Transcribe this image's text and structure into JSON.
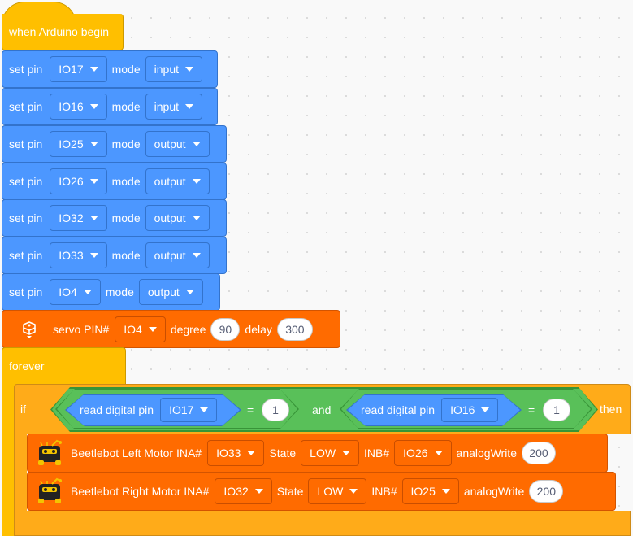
{
  "hat": {
    "label": "when Arduino begin"
  },
  "set_pin_blocks": [
    {
      "prefix": "set pin",
      "pin": "IO17",
      "mode_label": "mode",
      "mode": "input"
    },
    {
      "prefix": "set pin",
      "pin": "IO16",
      "mode_label": "mode",
      "mode": "input"
    },
    {
      "prefix": "set pin",
      "pin": "IO25",
      "mode_label": "mode",
      "mode": "output"
    },
    {
      "prefix": "set pin",
      "pin": "IO26",
      "mode_label": "mode",
      "mode": "output"
    },
    {
      "prefix": "set pin",
      "pin": "IO32",
      "mode_label": "mode",
      "mode": "output"
    },
    {
      "prefix": "set pin",
      "pin": "IO33",
      "mode_label": "mode",
      "mode": "output"
    },
    {
      "prefix": "set pin",
      "pin": "IO4",
      "mode_label": "mode",
      "mode": "output"
    }
  ],
  "servo": {
    "label": "servo PIN#",
    "pin": "IO4",
    "degree_label": "degree",
    "degree": "90",
    "delay_label": "delay",
    "delay": "300",
    "icon": "servo-icon"
  },
  "forever": {
    "label": "forever"
  },
  "if_block": {
    "if_label": "if",
    "then_label": "then",
    "and_label": "and",
    "left": {
      "read_label": "read digital pin",
      "pin": "IO17",
      "op": "=",
      "value": "1"
    },
    "right": {
      "read_label": "read digital pin",
      "pin": "IO16",
      "op": "=",
      "value": "1"
    }
  },
  "motors": [
    {
      "label": "Beetlebot Left Motor INA#",
      "ina": "IO33",
      "state_label": "State",
      "state": "LOW",
      "inb_label": "INB#",
      "inb": "IO26",
      "aw_label": "analogWrite",
      "aw": "200",
      "icon": "beetlebot-icon"
    },
    {
      "label": "Beetlebot Right Motor INA#",
      "ina": "IO32",
      "state_label": "State",
      "state": "LOW",
      "inb_label": "INB#",
      "inb": "IO25",
      "aw_label": "analogWrite",
      "aw": "200",
      "icon": "beetlebot-icon"
    }
  ],
  "colors": {
    "motion_blue": "#4c97ff",
    "event_yellow": "#ffbf00",
    "extension_orange": "#ff6b00",
    "operator_green": "#59c059"
  }
}
